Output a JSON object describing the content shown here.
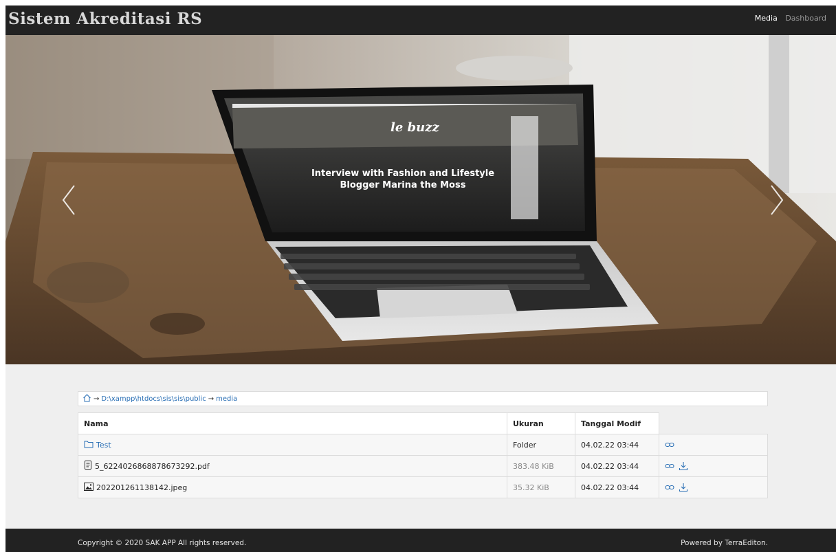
{
  "navbar": {
    "brand": "Sistem Akreditasi RS",
    "links": [
      {
        "label": "Media",
        "active": true
      },
      {
        "label": "Dashboard",
        "active": false
      }
    ]
  },
  "carousel": {
    "screen_headline_line1": "Interview with Fashion and Lifestyle",
    "screen_headline_line2": "Blogger Marina the Moss",
    "screen_logo": "le buzz",
    "prev_icon": "chevron-left-icon",
    "next_icon": "chevron-right-icon"
  },
  "breadcrumb": {
    "home_icon": "home-icon",
    "items": [
      "D:\\xampp\\htdocs\\sis\\sis\\public",
      "media"
    ],
    "separator": "→"
  },
  "table": {
    "headers": {
      "name": "Nama",
      "size": "Ukuran",
      "date": "Tanggal Modif"
    },
    "rows": [
      {
        "name": "Test",
        "size": "Folder",
        "date": "04.02.22 03:44",
        "icon": "folder-icon",
        "actions": [
          "link-icon"
        ]
      },
      {
        "name": "5_6224026868878673292.pdf",
        "size": "383.48 KiB",
        "date": "04.02.22 03:44",
        "icon": "pdf-file-icon",
        "actions": [
          "link-icon",
          "download-icon"
        ]
      },
      {
        "name": "202201261138142.jpeg",
        "size": "35.32 KiB",
        "date": "04.02.22 03:44",
        "icon": "image-file-icon",
        "actions": [
          "link-icon",
          "download-icon"
        ]
      }
    ]
  },
  "footer": {
    "copyright": "Copyright © 2020 SAK APP All rights reserved.",
    "powered": "Powered by TerraEditon."
  },
  "colors": {
    "navbar_bg": "#222222",
    "link": "#2a6fb5",
    "page_bg": "#efefef"
  }
}
